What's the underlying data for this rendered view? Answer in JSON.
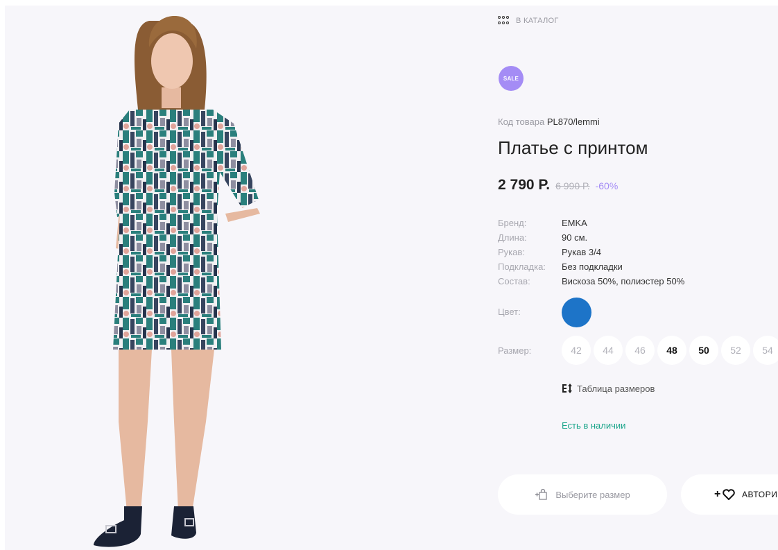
{
  "catalog": {
    "label": "В КАТАЛОГ"
  },
  "badge": {
    "label": "SALE"
  },
  "product": {
    "sku_label": "Код товара",
    "sku": "PL870/lemmi",
    "title": "Платье с принтом",
    "price": "2 790 Р.",
    "old_price": "6 990 Р.",
    "discount": "-60%"
  },
  "specs": [
    {
      "key": "Бренд:",
      "value": "EMKA"
    },
    {
      "key": "Длина:",
      "value": "90 см."
    },
    {
      "key": "Рукав:",
      "value": "Рукав 3/4"
    },
    {
      "key": "Подкладка:",
      "value": "Без подкладки"
    },
    {
      "key": "Состав:",
      "value": "Вискоза 50%, полиэстер 50%"
    }
  ],
  "color": {
    "label": "Цвет:",
    "swatch": "#1d74c8"
  },
  "size": {
    "label": "Размер:",
    "options": [
      "42",
      "44",
      "46",
      "48",
      "50",
      "52",
      "54"
    ]
  },
  "size_table": {
    "label": "Таблица размеров"
  },
  "stock": {
    "label": "Есть в наличии"
  },
  "buttons": {
    "cart": "Выберите размер",
    "favorites": "АВТОРИЗ"
  },
  "colors": {
    "accent": "#a48cf5",
    "stock": "#1aa58a",
    "swatch": "#1d74c8"
  }
}
